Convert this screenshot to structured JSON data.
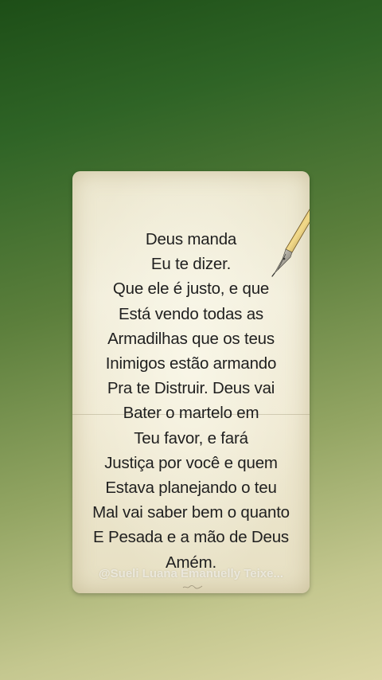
{
  "poem": {
    "lines": [
      "Deus manda",
      "Eu te dizer.",
      "Que ele é justo, e que",
      "Está vendo todas as",
      "Armadilhas que os teus",
      "Inimigos estão armando",
      "Pra te Distruir. Deus vai",
      "Bater o martelo em",
      "Teu favor, e fará",
      "Justiça por você e quem",
      "Estava planejando o teu",
      "Mal vai  saber bem o quanto",
      "E Pesada e a mão de Deus",
      "Amém."
    ]
  },
  "watermark": {
    "text": "@Sueli Luana Emanuelly Teixe..."
  },
  "colors": {
    "background_top": "#1d4e17",
    "background_bottom": "#dcd7a6",
    "paper": "#efe9d2",
    "text": "#1f1f1f"
  },
  "icons": {
    "quill": "fountain-pen-nib-icon"
  }
}
